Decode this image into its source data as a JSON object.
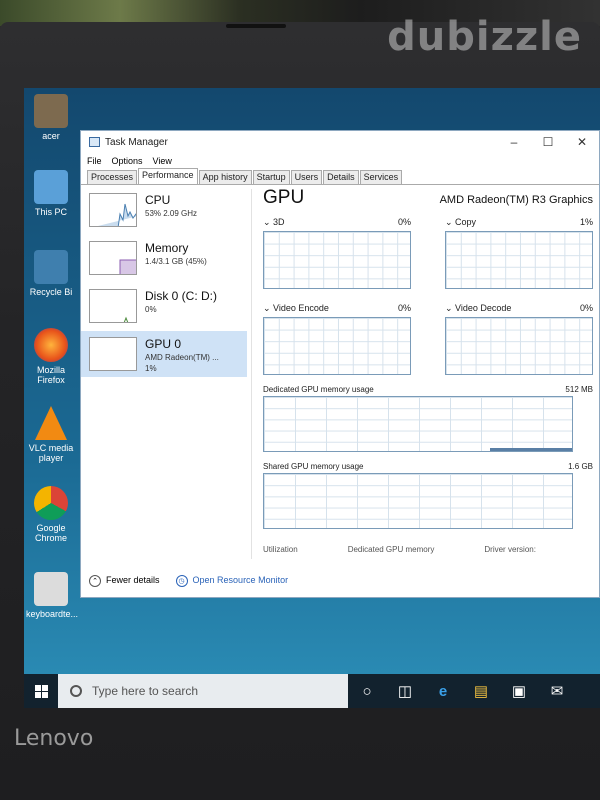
{
  "watermark": "dubizzle",
  "laptop_brand": "Lenovo",
  "desktop_icons": [
    {
      "label": "acer",
      "icon": "recycle-icon"
    },
    {
      "label": "This PC",
      "icon": "computer-icon"
    },
    {
      "label": "Recycle Bi",
      "icon": "recycle-bin-icon"
    },
    {
      "label": "Mozilla Firefox",
      "icon": "firefox-icon"
    },
    {
      "label": "VLC media player",
      "icon": "vlc-icon"
    },
    {
      "label": "Google Chrome",
      "icon": "chrome-icon"
    },
    {
      "label": "keyboardte...",
      "icon": "keyboard-test-icon"
    }
  ],
  "window": {
    "title": "Task Manager",
    "menu": [
      "File",
      "Options",
      "View"
    ],
    "tabs": [
      "Processes",
      "Performance",
      "App history",
      "Startup",
      "Users",
      "Details",
      "Services"
    ],
    "active_tab": "Performance"
  },
  "sidebar": [
    {
      "name": "CPU",
      "detail": "53% 2.09 GHz",
      "selected": false
    },
    {
      "name": "Memory",
      "detail": "1.4/3.1 GB (45%)",
      "selected": false
    },
    {
      "name": "Disk 0 (C: D:)",
      "detail": "0%",
      "selected": false
    },
    {
      "name": "GPU 0",
      "detail": "AMD Radeon(TM) ...",
      "detail2": "1%",
      "selected": true
    }
  ],
  "gpu": {
    "title": "GPU",
    "name": "AMD Radeon(TM) R3 Graphics",
    "graphs": [
      {
        "label": "3D",
        "value": "0%"
      },
      {
        "label": "Copy",
        "value": "1%"
      },
      {
        "label": "Video Encode",
        "value": "0%"
      },
      {
        "label": "Video Decode",
        "value": "0%"
      }
    ],
    "dedicated": {
      "label": "Dedicated GPU memory usage",
      "max": "512 MB"
    },
    "shared": {
      "label": "Shared GPU memory usage",
      "max": "1.6 GB"
    },
    "stats": [
      "Utilization",
      "Dedicated GPU memory",
      "Driver version:"
    ]
  },
  "footer": {
    "fewer": "Fewer details",
    "monitor": "Open Resource Monitor"
  },
  "taskbar": {
    "search_placeholder": "Type here to search"
  },
  "colors": {
    "accent": "#2a63b8",
    "selection": "#cfe2f6",
    "graph_border": "#7a9bb8",
    "desktop": "#1b6a94"
  }
}
